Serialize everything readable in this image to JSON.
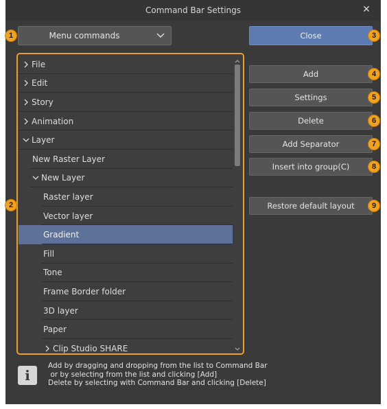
{
  "window": {
    "title": "Command Bar Settings",
    "close_glyph": "✕"
  },
  "dropdown": {
    "value": "Menu commands",
    "chevron_icon": "chevron-down-icon"
  },
  "buttons": {
    "close": "Close",
    "add": "Add",
    "settings": "Settings",
    "delete": "Delete",
    "add_separator": "Add Separator",
    "insert_group": "Insert into group(C)",
    "restore": "Restore default layout"
  },
  "tree": [
    {
      "label": "File",
      "expander": "collapsed",
      "level": 0
    },
    {
      "label": "Edit",
      "expander": "collapsed",
      "level": 0
    },
    {
      "label": "Story",
      "expander": "collapsed",
      "level": 0
    },
    {
      "label": "Animation",
      "expander": "collapsed",
      "level": 0
    },
    {
      "label": "Layer",
      "expander": "expanded",
      "level": 0
    },
    {
      "label": "New Raster Layer",
      "expander": "none",
      "level": 1
    },
    {
      "label": "New Layer",
      "expander": "expanded",
      "level": 1
    },
    {
      "label": "Raster layer",
      "expander": "none",
      "level": 2
    },
    {
      "label": "Vector layer",
      "expander": "none",
      "level": 2
    },
    {
      "label": "Gradient",
      "expander": "none",
      "level": 2,
      "selected": true
    },
    {
      "label": "Fill",
      "expander": "none",
      "level": 2
    },
    {
      "label": "Tone",
      "expander": "none",
      "level": 2
    },
    {
      "label": "Frame Border folder",
      "expander": "none",
      "level": 2
    },
    {
      "label": "3D layer",
      "expander": "none",
      "level": 2
    },
    {
      "label": "Paper",
      "expander": "none",
      "level": 2
    },
    {
      "label": "Clip Studio SHARE",
      "expander": "collapsed",
      "level": 2
    }
  ],
  "info": {
    "icon": "info-icon",
    "icon_glyph": "i",
    "lines": [
      "Add by dragging and dropping from the list to Command Bar",
      " or by selecting from the list and clicking [Add]",
      "Delete by selecting with Command Bar and clicking [Delete]"
    ]
  },
  "badges": [
    "1",
    "2",
    "3",
    "4",
    "5",
    "6",
    "7",
    "8",
    "9"
  ],
  "colors": {
    "accent_orange": "#f3a21c",
    "selection": "#5d7199",
    "primary_button": "#5b7bb1",
    "dialog_bg": "#3a3a3a"
  }
}
